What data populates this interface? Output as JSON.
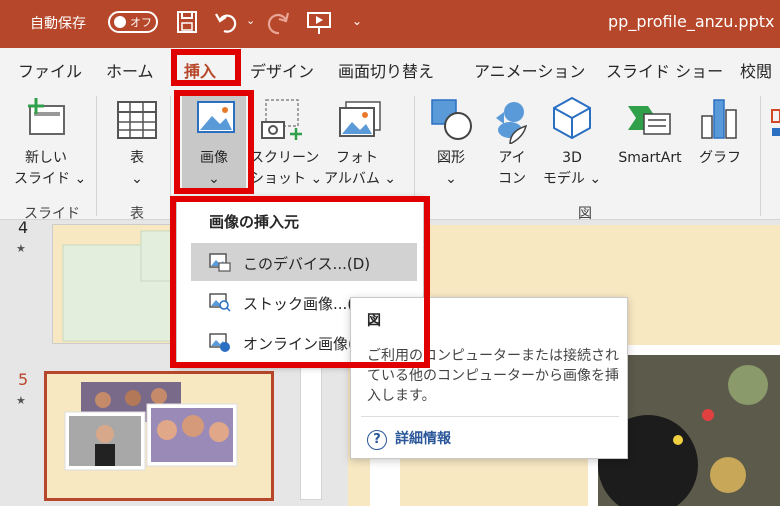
{
  "titlebar": {
    "autosave_label": "自動保存",
    "autosave_state": "オフ",
    "filename": "pp_profile_anzu.pptx"
  },
  "tabs": [
    "ファイル",
    "ホーム",
    "挿入",
    "デザイン",
    "画面切り替え",
    "アニメーション",
    "スライド ショー",
    "校閲"
  ],
  "active_tab": "挿入",
  "ribbon": {
    "new_slide": [
      "新しい",
      "スライド ⌄"
    ],
    "table": [
      "表",
      "⌄"
    ],
    "picture": [
      "画像",
      "⌄"
    ],
    "screenshot": [
      "スクリーン",
      "ショット ⌄"
    ],
    "photo_album": [
      "フォト",
      "アルバム ⌄"
    ],
    "shapes": [
      "図形",
      "⌄"
    ],
    "icons": [
      "アイ",
      "コン"
    ],
    "model3d": [
      "3D",
      "モデル ⌄"
    ],
    "smartart": "SmartArt",
    "chart": "グラフ",
    "group_slides": "スライド",
    "group_table": "表",
    "group_illustrations": "図"
  },
  "slides_pane": {
    "slide4_number": "4",
    "slide5_number": "5",
    "star": "★"
  },
  "dropdown": {
    "header": "画像の挿入元",
    "items": [
      "このデバイス...(D)",
      "ストック画像...(S)",
      "オンライン画像(O)"
    ]
  },
  "tooltip": {
    "title": "図",
    "description": "ご利用のコンピューターまたは接続されている他のコンピューターから画像を挿入します。",
    "more_info": "詳細情報",
    "more_icon": "?"
  },
  "colors": {
    "brand": "#b7472a",
    "highlight": "#e00000",
    "link": "#2b579a"
  }
}
